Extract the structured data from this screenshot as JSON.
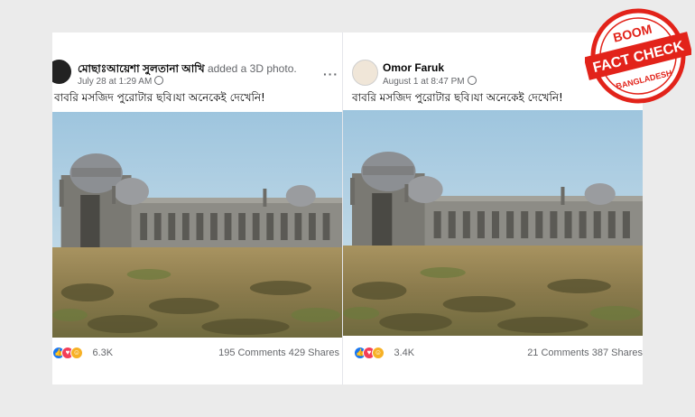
{
  "posts": [
    {
      "author": "মোছাঃআয়েশা সুলতানা আখি",
      "action": "added a 3D photo.",
      "timestamp": "July 28 at 1:29 AM",
      "more": "···",
      "caption": "বাবরি মসজিদ পুরোটার ছবি।যা অনেকেই দেখেনি!",
      "reaction_count": "6.3K",
      "comments": "195 Comments",
      "shares": "429 Shares"
    },
    {
      "author": "Omor Faruk",
      "timestamp": "August 1 at 8:47 PM",
      "caption": "বাবরি মসজিদ পুরোটার ছবি।যা অনেকেই দেখেনি!",
      "reaction_count": "3.4K",
      "comments": "21 Comments",
      "shares": "387 Shares"
    }
  ],
  "stamp": {
    "brand": "BOOM",
    "title": "FACT CHECK",
    "region": "BANGLADESH",
    "color": "#e2231a"
  },
  "icons": {
    "privacy": "globe-icon",
    "reactions": [
      "like-icon",
      "love-icon",
      "haha-icon"
    ]
  }
}
